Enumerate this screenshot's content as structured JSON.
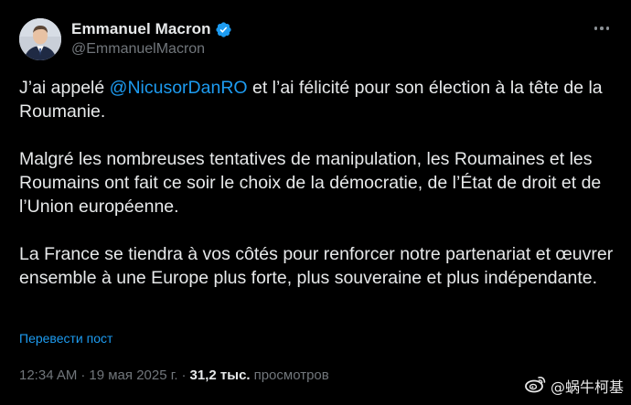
{
  "author": {
    "display_name": "Emmanuel Macron",
    "handle": "@EmmanuelMacron",
    "verified": true,
    "badge_color": "#1d9bf0"
  },
  "icons": {
    "avatar": "avatar-photo",
    "verified": "verified-badge-icon",
    "more": "more-options-icon",
    "watermark": "weibo-icon"
  },
  "tweet": {
    "p1": {
      "before": "J’ai appelé ",
      "mention": "@NicusorDanRO",
      "after": " et l’ai félicité pour son élection à la tête de la Roumanie."
    },
    "p2": "Malgré les nombreuses tentatives de manipulation, les Roumaines et les Roumains ont fait ce soir le choix de la démocratie, de l’État de droit et de l’Union européenne.",
    "p3": "La France se tiendra à vos côtés pour renforcer notre partenariat et œuvrer ensemble à une Europe plus forte, plus souveraine et plus indépendante."
  },
  "translate_label": "Перевести пост",
  "meta": {
    "time": "12:34 AM",
    "separator": "·",
    "date": "19 мая 2025 г.",
    "views_count": "31,2 тыс.",
    "views_label": "просмотров"
  },
  "watermark": {
    "text": "@蜗牛柯基"
  },
  "colors": {
    "background": "#000000",
    "text": "#e7e9ea",
    "secondary": "#71767b",
    "accent": "#1d9bf0"
  }
}
